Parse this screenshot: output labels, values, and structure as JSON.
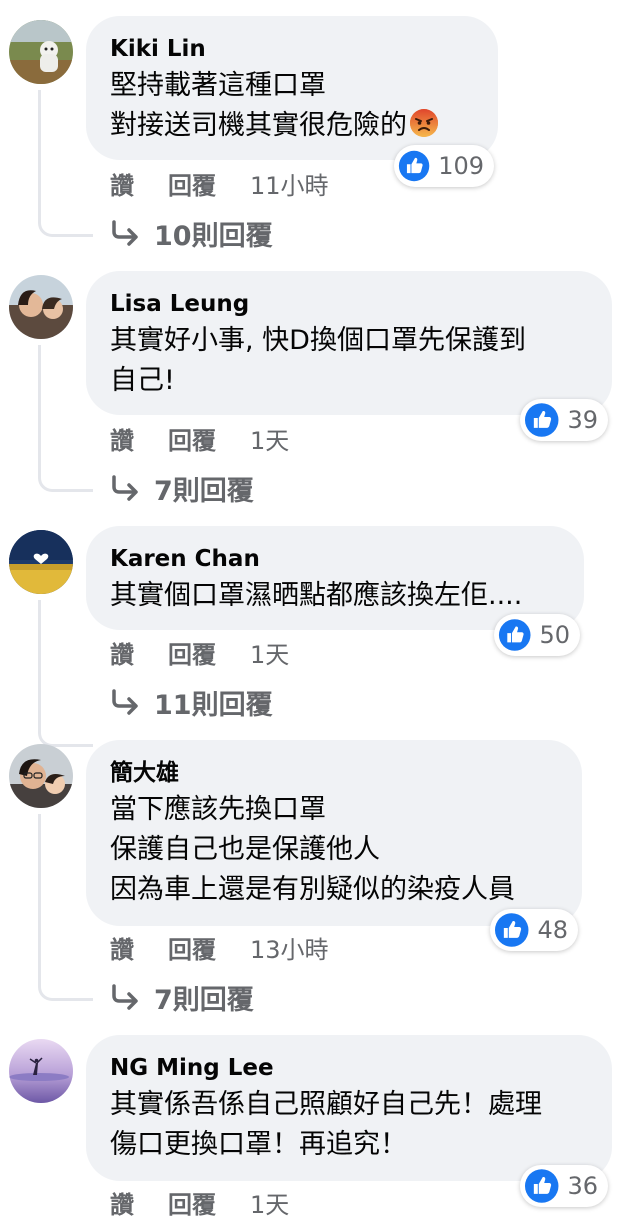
{
  "comments": [
    {
      "author": "Kiki Lin",
      "lines": "堅持載著這種口罩\n對接送司機其實很危險的",
      "emoji": "angry-face-icon",
      "reaction_count": "109",
      "like_label": "讚",
      "reply_label": "回覆",
      "time": "11小時",
      "replies_label": "10則回覆"
    },
    {
      "author": "Lisa Leung",
      "lines": "其實好小事, 快D換個口罩先保護到\n自己!",
      "reaction_count": "39",
      "like_label": "讚",
      "reply_label": "回覆",
      "time": "1天",
      "replies_label": "7則回覆"
    },
    {
      "author": "Karen Chan",
      "lines": "其實個口罩濕晒點都應該換左佢....",
      "reaction_count": "50",
      "like_label": "讚",
      "reply_label": "回覆",
      "time": "1天",
      "replies_label": "11則回覆"
    },
    {
      "author": "簡大雄",
      "lines": "當下應該先換口罩\n保護自己也是保護他人\n因為車上還是有別疑似的染疫人員",
      "reaction_count": "48",
      "like_label": "讚",
      "reply_label": "回覆",
      "time": "13小時",
      "replies_label": "7則回覆"
    },
    {
      "author": "NG Ming Lee",
      "lines": "其實係吾係自己照顧好自己先！處理\n傷口更換口罩！再追究！",
      "reaction_count": "36",
      "like_label": "讚",
      "reply_label": "回覆",
      "time": "1天"
    }
  ],
  "colors": {
    "like_blue": "#1877f2",
    "secondary_text": "#65676b",
    "bubble_bg": "#f0f2f5"
  }
}
